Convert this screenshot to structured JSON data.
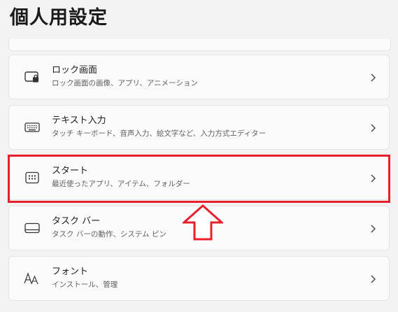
{
  "header": {
    "title": "個人用設定"
  },
  "items": [
    {
      "key": "lock-screen",
      "title": "ロック画面",
      "subtitle": "ロック画面の画像、アプリ、アニメーション",
      "icon": "lock-screen-icon"
    },
    {
      "key": "text-input",
      "title": "テキスト入力",
      "subtitle": "タッチ キーボード、音声入力、絵文字など、入力方式エディター",
      "icon": "keyboard-icon"
    },
    {
      "key": "start",
      "title": "スタート",
      "subtitle": "最近使ったアプリ、アイテム、フォルダー",
      "icon": "start-icon",
      "highlighted": true
    },
    {
      "key": "taskbar",
      "title": "タスク バー",
      "subtitle": "タスク バーの動作、システム ピン",
      "icon": "taskbar-icon"
    },
    {
      "key": "fonts",
      "title": "フォント",
      "subtitle": "インストール、管理",
      "icon": "font-icon"
    }
  ],
  "annotation": {
    "highlight_color": "#e8202c",
    "arrow_direction": "up"
  }
}
